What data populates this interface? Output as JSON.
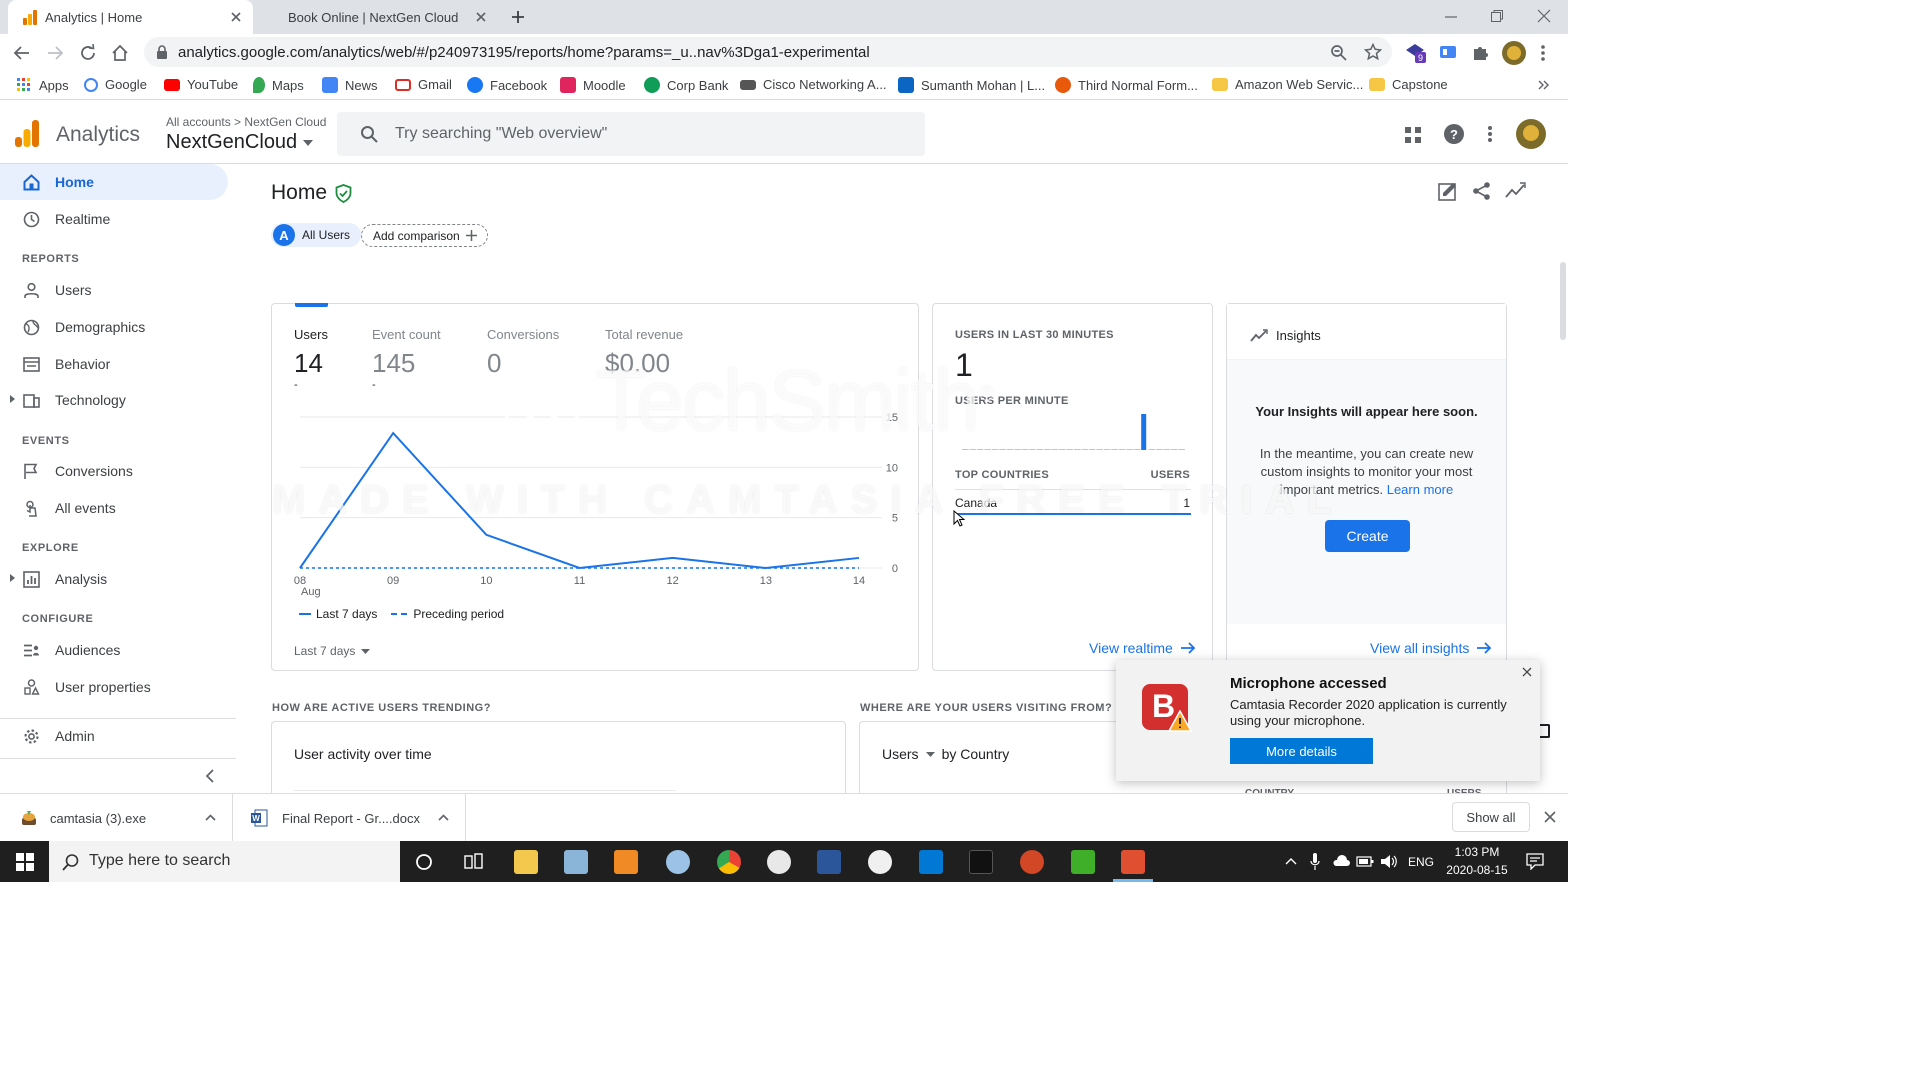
{
  "browser": {
    "tabs": [
      {
        "title": "Analytics | Home",
        "active": true
      },
      {
        "title": "Book Online | NextGen Cloud",
        "active": false
      }
    ],
    "url": "analytics.google.com/analytics/web/#/p240973195/reports/home?params=_u..nav%3Dga1-experimental",
    "bookmarks": [
      {
        "label": "Apps",
        "icon": "apps-grid-icon",
        "color": "#ea4335"
      },
      {
        "label": "Google",
        "icon": "google-icon",
        "color": "#4285f4"
      },
      {
        "label": "YouTube",
        "icon": "youtube-icon",
        "color": "#ff0000"
      },
      {
        "label": "Maps",
        "icon": "maps-pin-icon",
        "color": "#34a853"
      },
      {
        "label": "News",
        "icon": "news-icon",
        "color": "#4285f4"
      },
      {
        "label": "Gmail",
        "icon": "gmail-icon",
        "color": "#d93025"
      },
      {
        "label": "Facebook",
        "icon": "facebook-icon",
        "color": "#1877f2"
      },
      {
        "label": "Moodle",
        "icon": "moodle-icon",
        "color": "#e0245e"
      },
      {
        "label": "Corp Bank",
        "icon": "bank-icon",
        "color": "#0f9d58"
      },
      {
        "label": "Cisco Networking A...",
        "icon": "cisco-icon",
        "color": "#555555"
      },
      {
        "label": "Sumanth Mohan | L...",
        "icon": "linkedin-icon",
        "color": "#0a66c2"
      },
      {
        "label": "Third Normal Form...",
        "icon": "site-icon",
        "color": "#e8590c"
      },
      {
        "label": "Amazon Web Servic...",
        "icon": "folder-icon",
        "color": "#f6c744"
      },
      {
        "label": "Capstone",
        "icon": "folder-icon",
        "color": "#f6c744"
      }
    ]
  },
  "ga": {
    "product": "Analytics",
    "breadcrumb_all": "All accounts",
    "breadcrumb_sep": ">",
    "breadcrumb_account": "NextGen Cloud",
    "property": "NextGenCloud",
    "search_placeholder": "Try searching \"Web overview\""
  },
  "sidebar": {
    "items": [
      {
        "label": "Home",
        "icon": "home-icon"
      },
      {
        "label": "Realtime",
        "icon": "clock-icon"
      },
      {
        "label": "Users",
        "icon": "person-icon"
      },
      {
        "label": "Demographics",
        "icon": "globe-icon"
      },
      {
        "label": "Behavior",
        "icon": "behavior-icon"
      },
      {
        "label": "Technology",
        "icon": "devices-icon"
      },
      {
        "label": "Conversions",
        "icon": "flag-icon"
      },
      {
        "label": "All events",
        "icon": "touch-icon"
      },
      {
        "label": "Analysis",
        "icon": "analysis-icon"
      },
      {
        "label": "Audiences",
        "icon": "audiences-icon"
      },
      {
        "label": "User properties",
        "icon": "user-properties-icon"
      },
      {
        "label": "Admin",
        "icon": "gear-icon"
      }
    ],
    "sections": [
      "REPORTS",
      "EVENTS",
      "EXPLORE",
      "CONFIGURE"
    ]
  },
  "main": {
    "title": "Home",
    "segment_letter": "A",
    "segment_label": "All Users",
    "add_comparison": "Add comparison",
    "metrics": [
      {
        "label": "Users",
        "value": "14",
        "sub": "-"
      },
      {
        "label": "Event count",
        "value": "145",
        "sub": "-"
      },
      {
        "label": "Conversions",
        "value": "0",
        "sub": ""
      },
      {
        "label": "Total revenue",
        "value": "$0.00",
        "sub": ""
      }
    ],
    "legend_current": "Last 7 days",
    "legend_previous": "Preceding period",
    "date_range": "Last 7 days",
    "realtime": {
      "title": "USERS IN LAST 30 MINUTES",
      "value": "1",
      "per_minute": "USERS PER MINUTE",
      "top_countries": "TOP COUNTRIES",
      "users_col": "USERS",
      "country": "Canada",
      "country_users": "1",
      "link": "View realtime"
    },
    "insights": {
      "title": "Insights",
      "headline": "Your Insights will appear here soon.",
      "body": "In the meantime, you can create new custom insights to monitor your most important metrics.",
      "learn_more": "Learn more",
      "create": "Create",
      "link": "View all insights"
    },
    "trending_label": "HOW ARE ACTIVE USERS TRENDING?",
    "activity_title": "User activity over time",
    "visiting_label": "WHERE ARE YOUR USERS VISITING FROM?",
    "country_dropdown": "Users",
    "by_country": "by Country",
    "country_col": "COUNTRY",
    "users_col2": "USERS"
  },
  "chart_data": {
    "type": "line",
    "categories": [
      "08",
      "09",
      "10",
      "11",
      "12",
      "13",
      "14"
    ],
    "x_sublabel": "Aug",
    "series": [
      {
        "name": "Last 7 days",
        "values": [
          0,
          13.4,
          3.3,
          0,
          1,
          0,
          1
        ]
      },
      {
        "name": "Preceding period",
        "values": [
          0,
          0,
          0,
          0,
          0,
          0,
          0
        ]
      }
    ],
    "yticks": [
      0,
      5,
      10,
      15
    ],
    "ylim": [
      0,
      15
    ],
    "grid": true,
    "legend": "bottom",
    "colors": {
      "current": "#1a73e8",
      "previous": "#1a73e8"
    }
  },
  "realtime_bars": [
    0,
    0,
    0,
    0,
    0,
    0,
    0,
    0,
    0,
    0,
    0,
    0,
    0,
    0,
    0,
    0,
    0,
    0,
    0,
    0,
    0,
    0,
    0,
    0,
    1,
    0,
    0,
    0,
    0,
    0
  ],
  "watermark": {
    "brand": "TechSmith",
    "registered": "®",
    "line": "MADE WITH CAMTASIA FREE TRIAL"
  },
  "toast": {
    "title": "Microphone accessed",
    "body": "Camtasia Recorder 2020 application is currently using your microphone.",
    "button": "More details"
  },
  "downloads": [
    {
      "name": "camtasia (3).exe",
      "icon": "installer-icon"
    },
    {
      "name": "Final Report - Gr....docx",
      "icon": "word-doc-icon"
    }
  ],
  "download_show_all": "Show all",
  "taskbar": {
    "search_placeholder": "Type here to search",
    "language": "ENG",
    "time": "1:03 PM",
    "date": "2020-08-15",
    "apps": [
      {
        "icon": "file-explorer-icon",
        "color": "#f2c94c"
      },
      {
        "icon": "notepad-icon",
        "color": "#8ab4d8"
      },
      {
        "icon": "sublime-text-icon",
        "color": "#f08a24"
      },
      {
        "icon": "paint-icon",
        "color": "#9cc3e6"
      },
      {
        "icon": "chrome-icon",
        "color": "#4caf50"
      },
      {
        "icon": "slack-icon",
        "color": "#e8e8e8"
      },
      {
        "icon": "word-icon",
        "color": "#2b579a"
      },
      {
        "icon": "itunes-icon",
        "color": "#f0f0f0"
      },
      {
        "icon": "outlook-icon",
        "color": "#0078d4"
      },
      {
        "icon": "acrobat-icon",
        "color": "#111111"
      },
      {
        "icon": "powerpoint-icon",
        "color": "#d24726"
      },
      {
        "icon": "camtasia-green-icon",
        "color": "#3fae29"
      },
      {
        "icon": "camtasia-recorder-icon",
        "color": "#e04f2f"
      }
    ]
  }
}
